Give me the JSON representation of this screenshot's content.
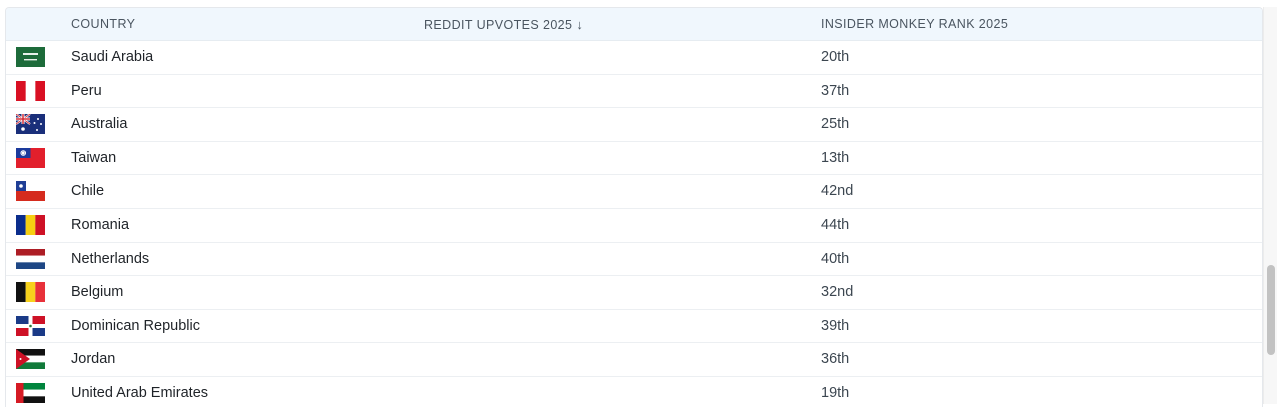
{
  "table": {
    "headers": {
      "country": "COUNTRY",
      "upvotes": "REDDIT UPVOTES 2025",
      "upvotes_sort_icon": "↓",
      "rank": "INSIDER MONKEY RANK 2025"
    },
    "rows": [
      {
        "flag": "saudi-arabia-flag",
        "country": "Saudi Arabia",
        "upvotes": "",
        "rank": "20th"
      },
      {
        "flag": "peru-flag",
        "country": "Peru",
        "upvotes": "",
        "rank": "37th"
      },
      {
        "flag": "australia-flag",
        "country": "Australia",
        "upvotes": "",
        "rank": "25th"
      },
      {
        "flag": "taiwan-flag",
        "country": "Taiwan",
        "upvotes": "",
        "rank": "13th"
      },
      {
        "flag": "chile-flag",
        "country": "Chile",
        "upvotes": "",
        "rank": "42nd"
      },
      {
        "flag": "romania-flag",
        "country": "Romania",
        "upvotes": "",
        "rank": "44th"
      },
      {
        "flag": "netherlands-flag",
        "country": "Netherlands",
        "upvotes": "",
        "rank": "40th"
      },
      {
        "flag": "belgium-flag",
        "country": "Belgium",
        "upvotes": "",
        "rank": "32nd"
      },
      {
        "flag": "dominican-republic-flag",
        "country": "Dominican Republic",
        "upvotes": "",
        "rank": "39th"
      },
      {
        "flag": "jordan-flag",
        "country": "Jordan",
        "upvotes": "",
        "rank": "36th"
      },
      {
        "flag": "united-arab-emirates-flag",
        "country": "United Arab Emirates",
        "upvotes": "",
        "rank": "19th"
      }
    ]
  },
  "colors": {
    "header_bg": "#f0f7fd",
    "row_border": "#eceff2",
    "text": "#1f2328",
    "scroll_thumb": "#c2c2c2"
  }
}
